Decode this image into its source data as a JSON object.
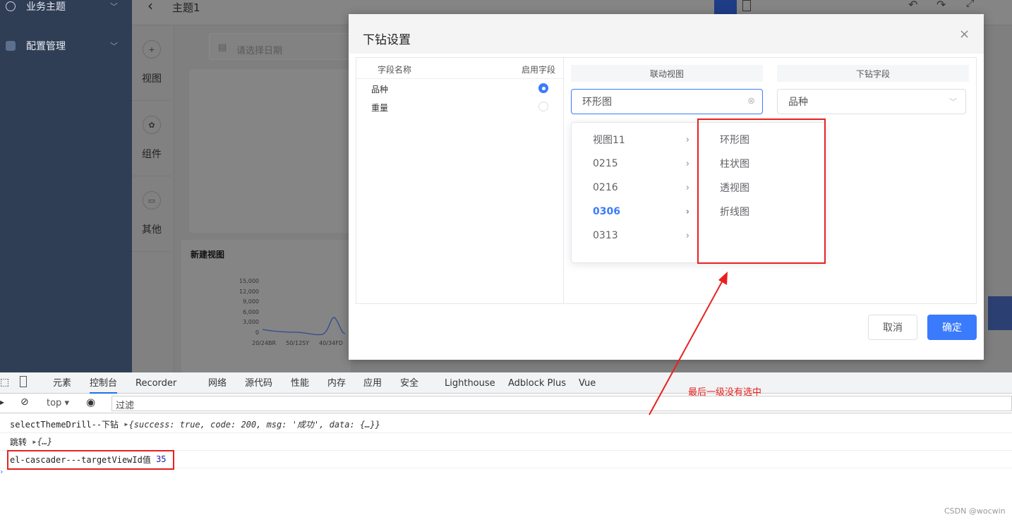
{
  "sidebar": {
    "items": [
      {
        "label": "业务主题",
        "icon": "palette-icon"
      },
      {
        "label": "配置管理",
        "icon": "settings-icon"
      }
    ]
  },
  "topbar": {
    "title": "主题1"
  },
  "tools": [
    {
      "label": "视图",
      "icon": "plus-circle-icon"
    },
    {
      "label": "组件",
      "icon": "gear-icon"
    },
    {
      "label": "其他",
      "icon": "widget-icon"
    }
  ],
  "canvas": {
    "date_placeholder": "请选择日期",
    "view_title": "新建视图",
    "chart_yticks": [
      "15,000",
      "12,000",
      "9,000",
      "6,000",
      "3,000",
      "0"
    ],
    "chart_xticks": [
      "20/24BR",
      "50/12SY",
      "40/34FD"
    ]
  },
  "dialog": {
    "title": "下钻设置",
    "left": {
      "col_name": "字段名称",
      "col_enable": "启用字段",
      "rows": [
        {
          "name": "品种",
          "enabled": true
        },
        {
          "name": "重量",
          "enabled": false
        }
      ]
    },
    "linked_view_label": "联动视图",
    "drill_field_label": "下钻字段",
    "linked_view_value": "环形图",
    "drill_field_value": "品种",
    "cascader": {
      "level1": [
        "视图11",
        "0215",
        "0216",
        "0306",
        "0313"
      ],
      "active": "0306",
      "level2": [
        "环形图",
        "柱状图",
        "透视图",
        "折线图"
      ]
    },
    "cancel": "取消",
    "confirm": "确定",
    "accent": "#3a7bfd"
  },
  "annotation": {
    "text": "最后一级没有选中",
    "color": "#e8211f"
  },
  "devtools": {
    "tabs": [
      "元素",
      "控制台",
      "Recorder",
      "网络",
      "源代码",
      "性能",
      "内存",
      "应用",
      "安全",
      "Lighthouse",
      "Adblock Plus",
      "Vue"
    ],
    "active_tab": "控制台",
    "context": "top",
    "filter": "过滤",
    "logs": [
      {
        "label": "selectThemeDrill--下钻",
        "obj": "{success: true, code: 200, msg: '成功', data: {…}}"
      },
      {
        "label": "跳转",
        "obj": "{…}"
      },
      {
        "label": "el-cascader---targetViewId值",
        "obj": "35"
      }
    ]
  },
  "watermark": "CSDN @wocwin"
}
